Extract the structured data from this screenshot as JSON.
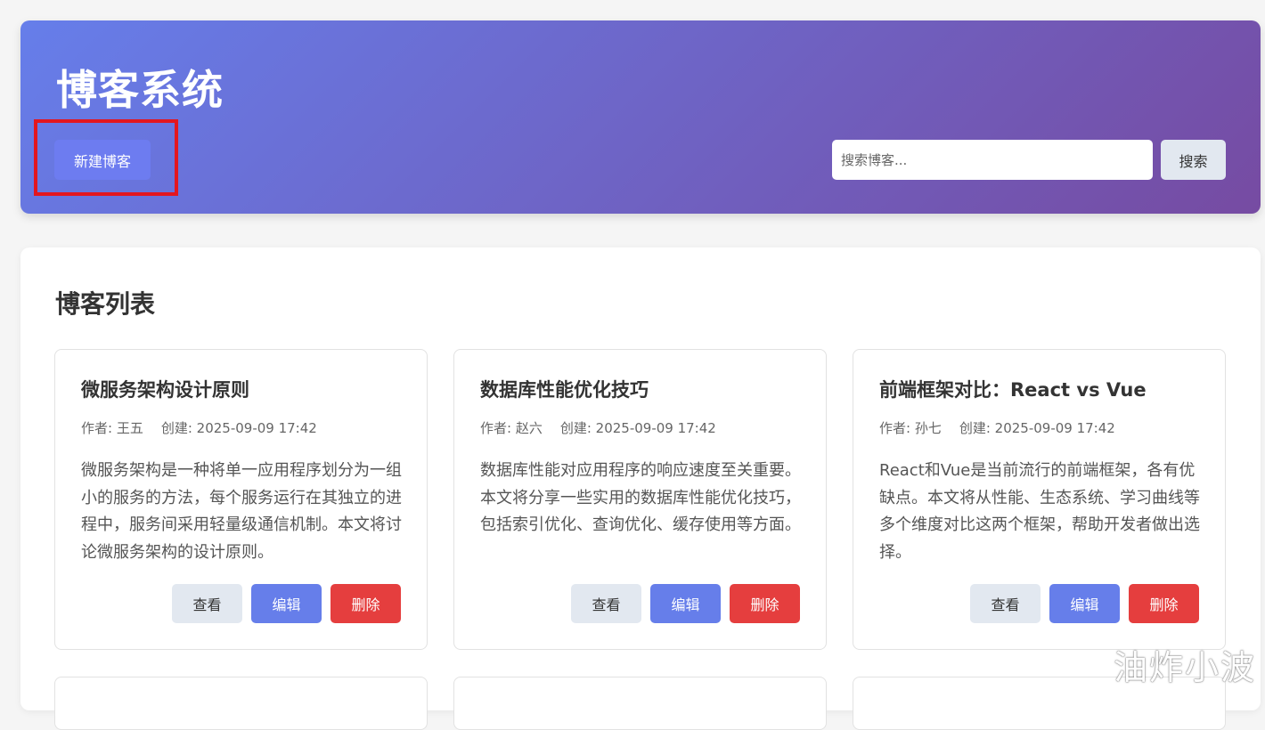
{
  "header": {
    "title": "博客系统",
    "new_blog_label": "新建博客",
    "search_placeholder": "搜索博客...",
    "search_label": "搜索"
  },
  "list": {
    "title": "博客列表",
    "action_labels": {
      "view": "查看",
      "edit": "编辑",
      "delete": "删除"
    },
    "posts": [
      {
        "title": "微服务架构设计原则",
        "author": "作者: 王五",
        "created": "创建: 2025-09-09 17:42",
        "excerpt": "微服务架构是一种将单一应用程序划分为一组小的服务的方法，每个服务运行在其独立的进程中，服务间采用轻量级通信机制。本文将讨论微服务架构的设计原则。"
      },
      {
        "title": "数据库性能优化技巧",
        "author": "作者: 赵六",
        "created": "创建: 2025-09-09 17:42",
        "excerpt": "数据库性能对应用程序的响应速度至关重要。本文将分享一些实用的数据库性能优化技巧，包括索引优化、查询优化、缓存使用等方面。"
      },
      {
        "title": "前端框架对比：React vs Vue",
        "author": "作者: 孙七",
        "created": "创建: 2025-09-09 17:42",
        "excerpt": "React和Vue是当前流行的前端框架，各有优缺点。本文将从性能、生态系统、学习曲线等多个维度对比这两个框架，帮助开发者做出选择。"
      }
    ]
  },
  "watermark": "油炸小波",
  "colors": {
    "header_gradient_start": "#667eea",
    "header_gradient_end": "#764ba2",
    "edit_button": "#667eea",
    "delete_button": "#e53e3e",
    "view_button": "#e2e8f0",
    "highlight": "#e3161f"
  }
}
